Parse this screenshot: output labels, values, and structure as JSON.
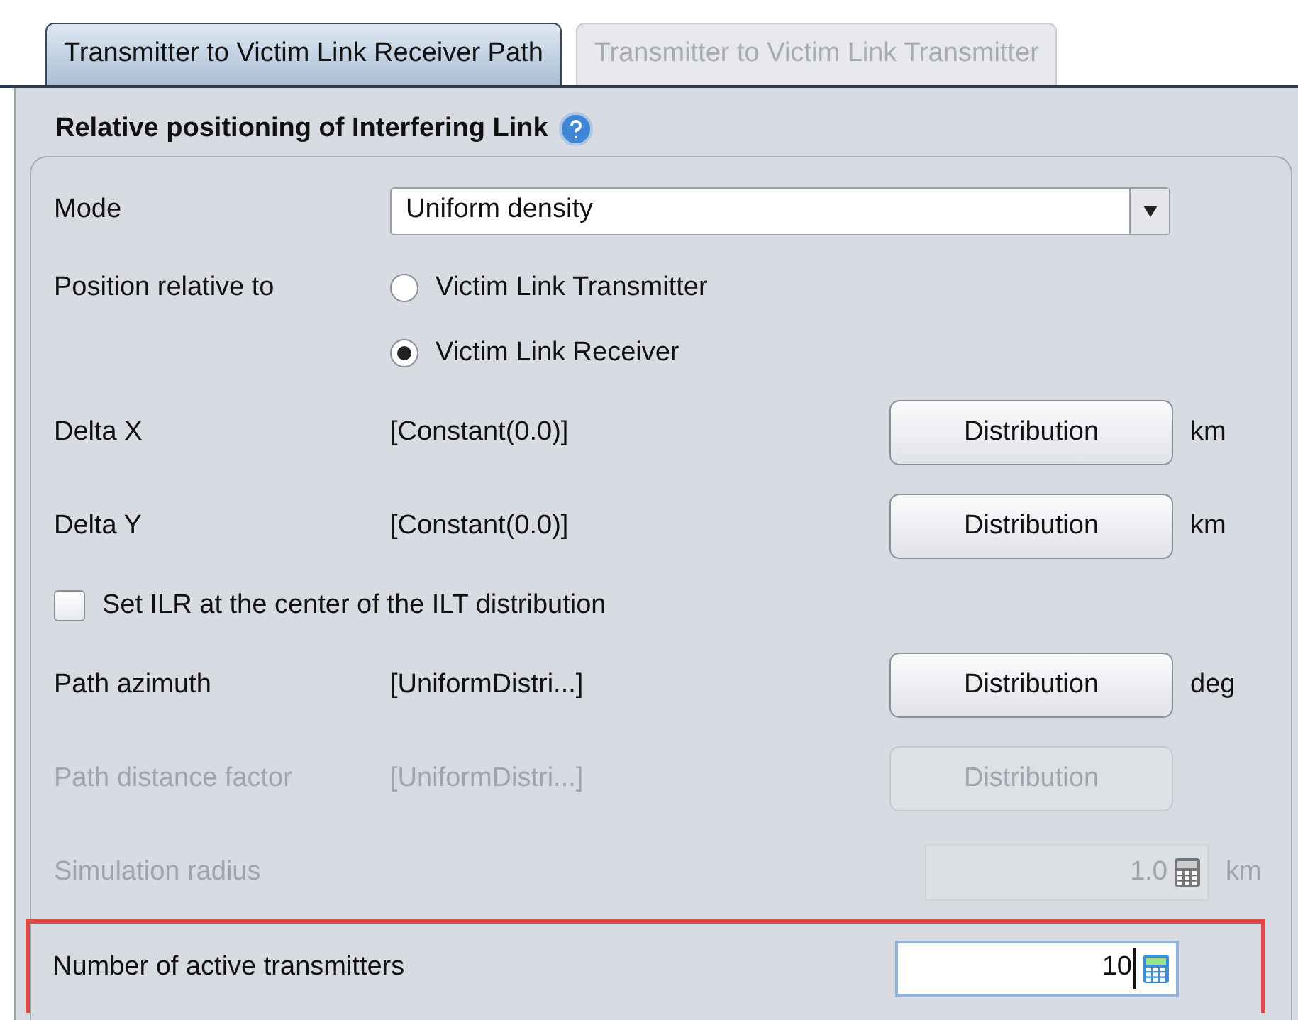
{
  "tabs": [
    {
      "label": "Transmitter to Victim Link Receiver Path",
      "selected": true
    },
    {
      "label": "Transmitter to Victim Link Transmitter",
      "selected": false
    }
  ],
  "section": {
    "title": "Relative positioning of Interfering Link"
  },
  "rows": [
    {
      "kind": "dropdown",
      "label": "Mode",
      "value": "Uniform density"
    },
    {
      "kind": "radio",
      "label": "Position relative to",
      "options": [
        {
          "label": "Victim Link Transmitter",
          "selected": false
        },
        {
          "label": "Victim Link Receiver",
          "selected": true
        }
      ]
    },
    {
      "kind": "distribution",
      "label": "Delta X",
      "value": "[Constant(0.0)]",
      "button": "Distribution",
      "unit": "km",
      "disabled": false
    },
    {
      "kind": "distribution",
      "label": "Delta Y",
      "value": "[Constant(0.0)]",
      "button": "Distribution",
      "unit": "km",
      "disabled": false
    },
    {
      "kind": "checkbox",
      "label": "Set ILR at the center of the ILT distribution",
      "checked": false
    },
    {
      "kind": "distribution",
      "label": "Path azimuth",
      "value": "[UniformDistri...]",
      "button": "Distribution",
      "unit": "deg",
      "disabled": false
    },
    {
      "kind": "distribution",
      "label": "Path distance factor",
      "value": "[UniformDistri...]",
      "button": "Distribution",
      "disabled": true
    },
    {
      "kind": "number",
      "label": "Simulation radius",
      "value": "1.0",
      "unit": "km",
      "disabled": true
    },
    {
      "kind": "number",
      "label": "Number of active transmitters",
      "value": "10",
      "disabled": false,
      "highlighted": true
    }
  ]
}
